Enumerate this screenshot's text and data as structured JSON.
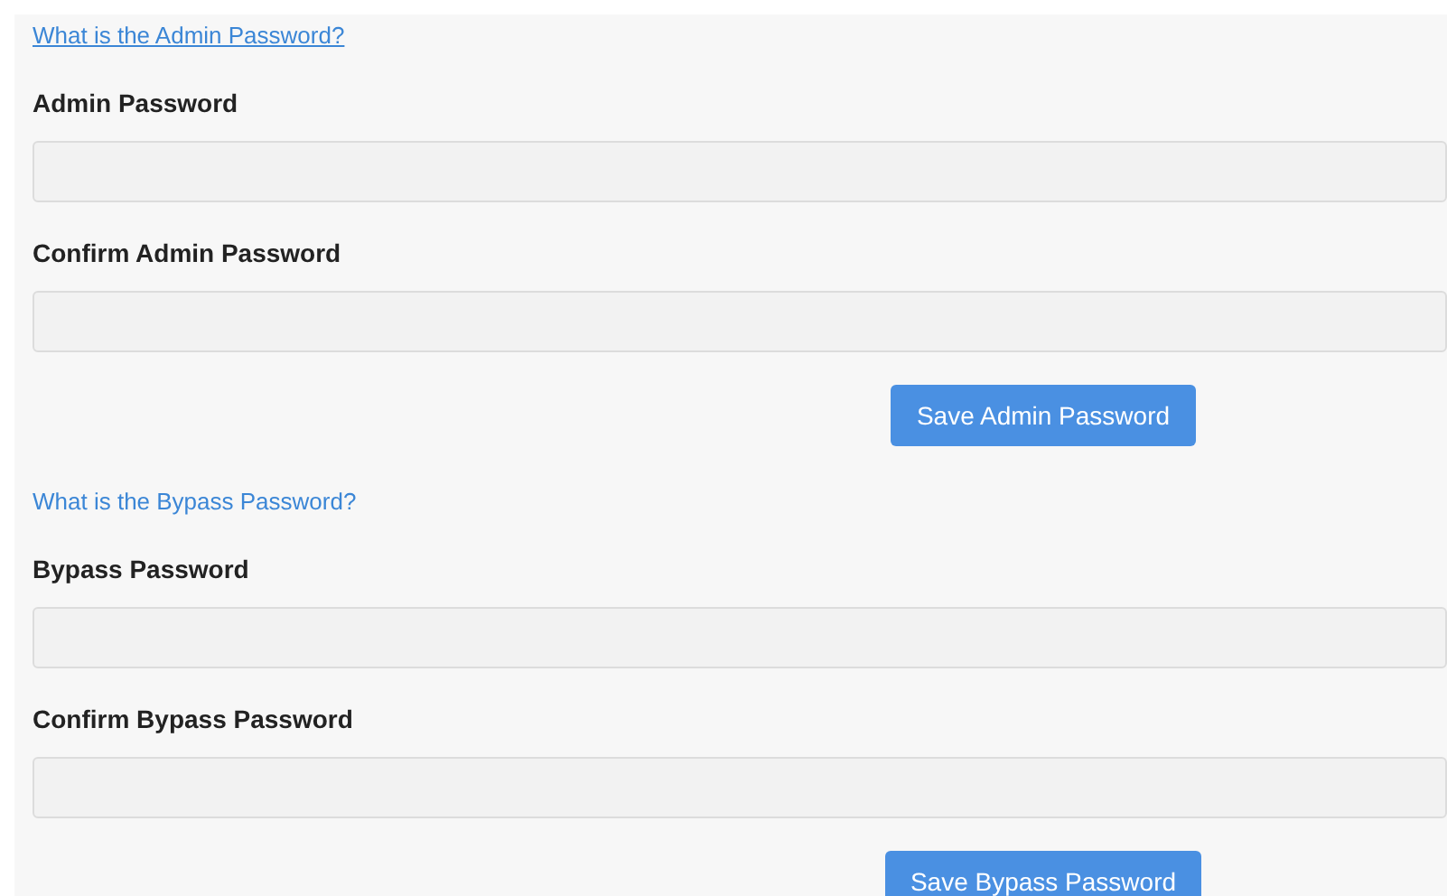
{
  "sections": [
    {
      "help_link": {
        "label": "What is the Admin Password?",
        "underlined": true
      },
      "fields": [
        {
          "label": "Admin Password"
        },
        {
          "label": "Confirm Admin Password"
        }
      ],
      "button": "Save Admin Password"
    },
    {
      "help_link": {
        "label": "What is the Bypass Password?",
        "underlined": false
      },
      "fields": [
        {
          "label": "Bypass Password"
        },
        {
          "label": "Confirm Bypass Password"
        }
      ],
      "button": "Save Bypass Password"
    }
  ]
}
